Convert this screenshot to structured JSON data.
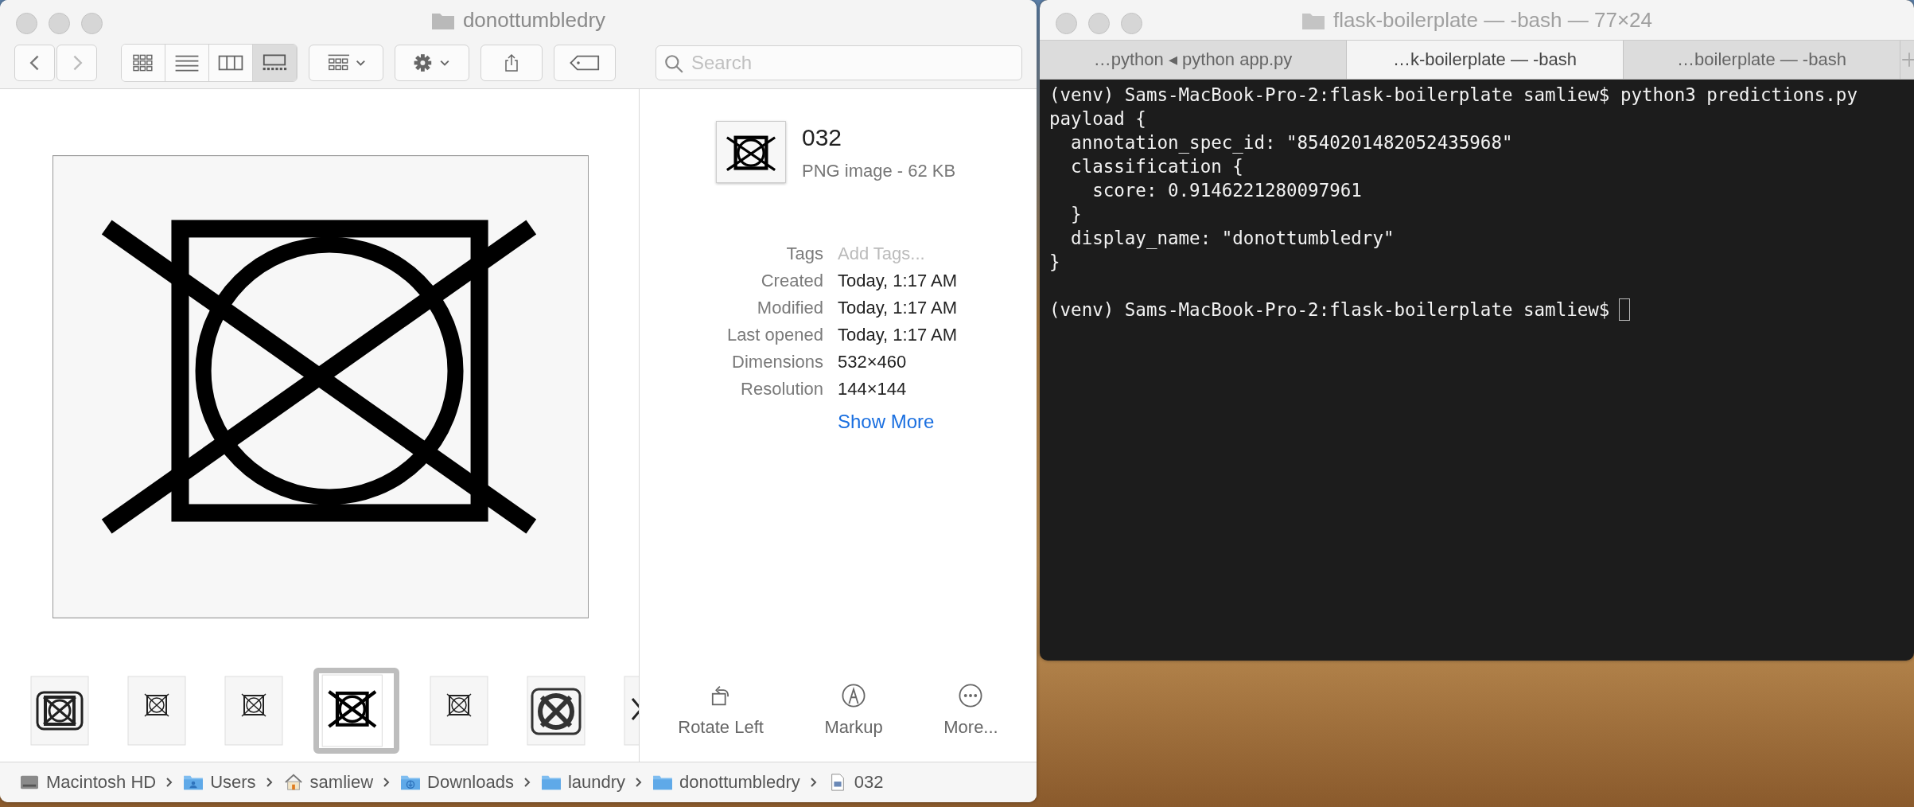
{
  "finder": {
    "title": "donottumbledry",
    "view_buttons": [
      {
        "kind": "icons",
        "selected": false
      },
      {
        "kind": "list",
        "selected": false
      },
      {
        "kind": "columns",
        "selected": false
      },
      {
        "kind": "gallery",
        "selected": true
      }
    ],
    "search": {
      "placeholder": "Search"
    },
    "file": {
      "name": "032",
      "type_size": "PNG image - 62 KB"
    },
    "tags": {
      "label": "Tags",
      "placeholder": "Add Tags..."
    },
    "info": [
      {
        "label": "Created",
        "value": "Today, 1:17 AM"
      },
      {
        "label": "Modified",
        "value": "Today, 1:17 AM"
      },
      {
        "label": "Last opened",
        "value": "Today, 1:17 AM"
      },
      {
        "label": "Dimensions",
        "value": "532×460"
      },
      {
        "label": "Resolution",
        "value": "144×144"
      }
    ],
    "show_more": "Show More",
    "thumbnails": [
      {
        "kind": "framed",
        "selected": false
      },
      {
        "kind": "small",
        "selected": false
      },
      {
        "kind": "small",
        "selected": false
      },
      {
        "kind": "crossed",
        "selected": true
      },
      {
        "kind": "small",
        "selected": false
      },
      {
        "kind": "circle",
        "selected": false
      },
      {
        "kind": "partial",
        "selected": false
      }
    ],
    "actions": [
      {
        "kind": "rotate",
        "label": "Rotate Left"
      },
      {
        "kind": "markup",
        "label": "Markup"
      },
      {
        "kind": "more",
        "label": "More..."
      }
    ],
    "path": [
      {
        "kind": "disk",
        "label": "Macintosh HD"
      },
      {
        "kind": "users",
        "label": "Users"
      },
      {
        "kind": "home",
        "label": "samliew"
      },
      {
        "kind": "downloads",
        "label": "Downloads"
      },
      {
        "kind": "folder",
        "label": "laundry"
      },
      {
        "kind": "folder",
        "label": "donottumbledry"
      },
      {
        "kind": "file",
        "label": "032"
      }
    ]
  },
  "terminal": {
    "title": "flask-boilerplate — -bash — 77×24",
    "tabs": [
      {
        "label": "…python ◂ python app.py",
        "selected": false
      },
      {
        "label": "…k-boilerplate — -bash",
        "selected": true
      },
      {
        "label": "…boilerplate — -bash",
        "selected": false
      }
    ],
    "output": [
      "(venv) Sams-MacBook-Pro-2:flask-boilerplate samliew$ python3 predictions.py",
      "payload {",
      "  annotation_spec_id: \"8540201482052435968\"",
      "  classification {",
      "    score: 0.9146221280097961",
      "  }",
      "  display_name: \"donottumbledry\"",
      "}"
    ],
    "prompt": "(venv) Sams-MacBook-Pro-2:flask-boilerplate samliew$"
  }
}
